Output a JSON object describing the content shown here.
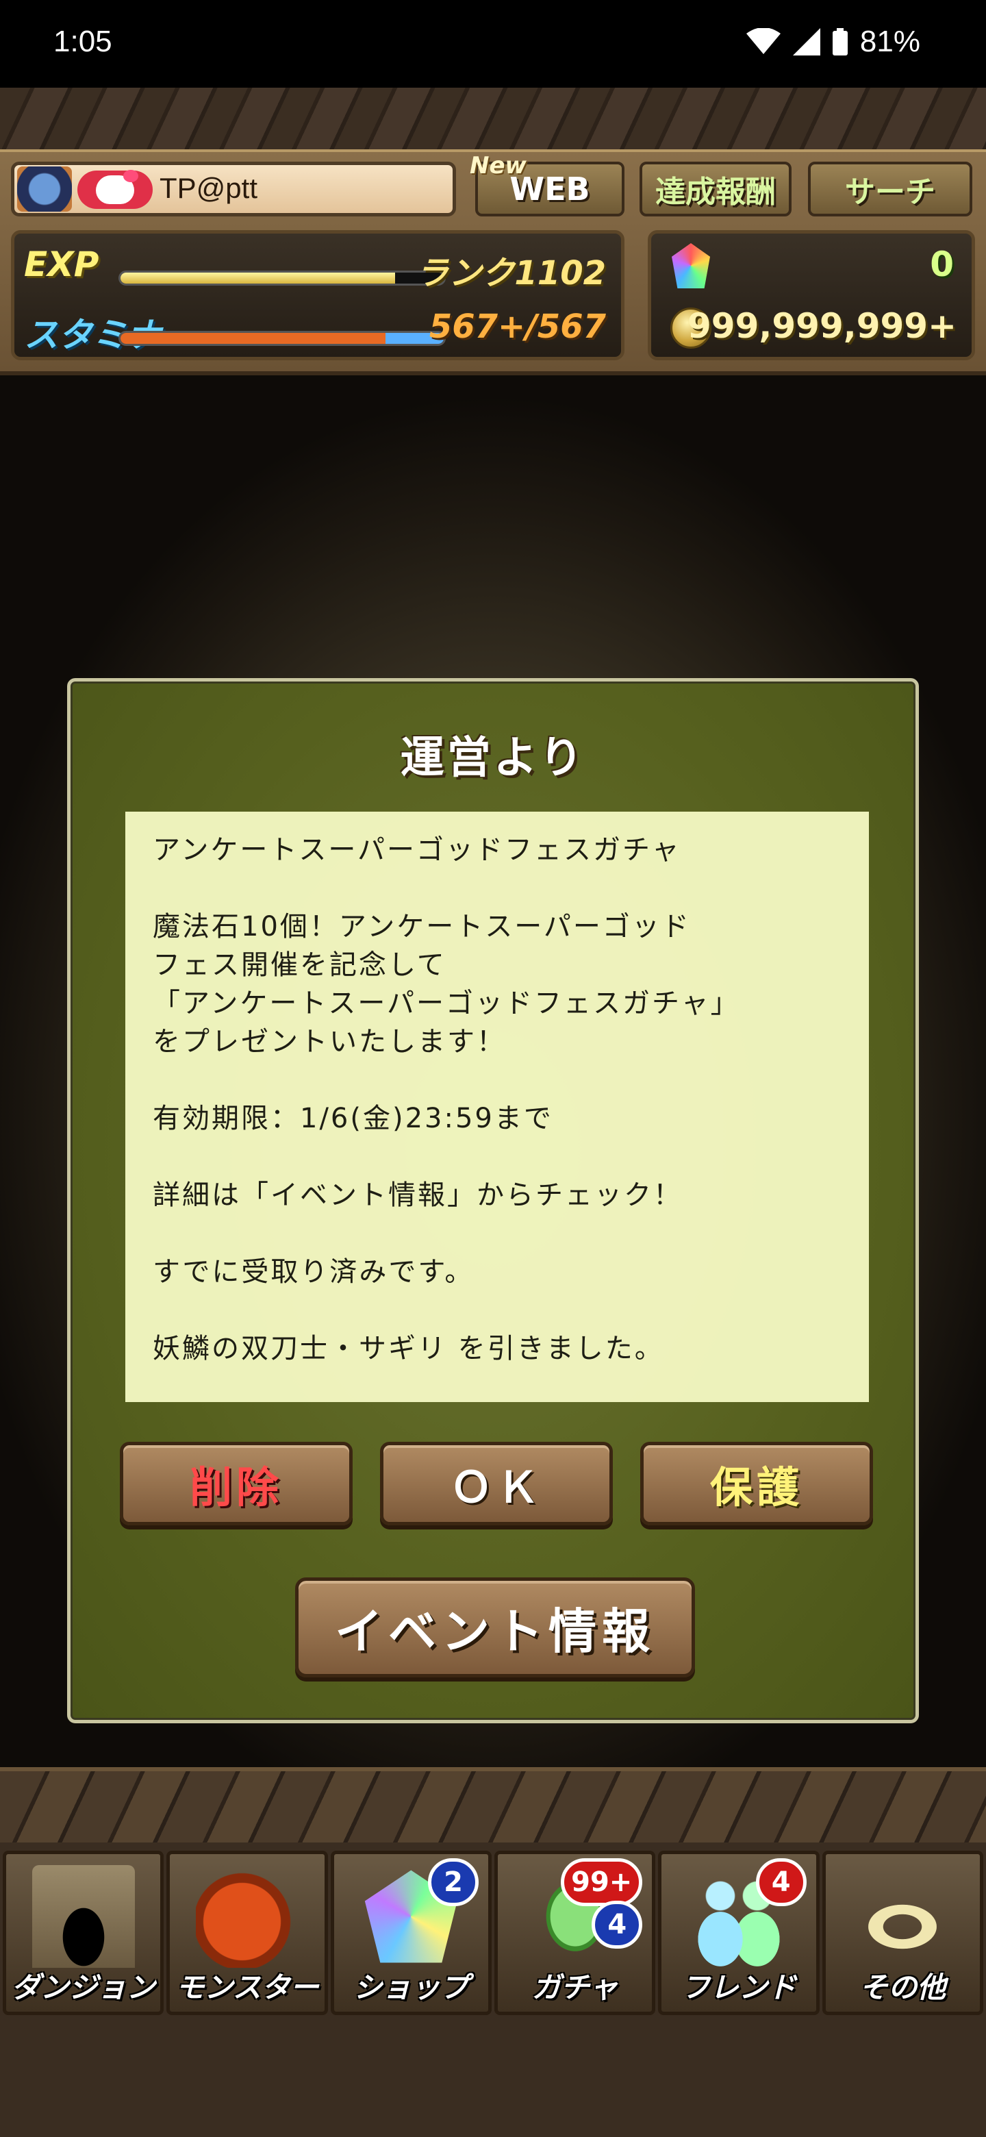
{
  "status_bar": {
    "time": "1:05",
    "battery": "81%",
    "icons": [
      "wifi-icon",
      "cellular-signal-icon",
      "battery-icon"
    ]
  },
  "header": {
    "username": "TP@ptt",
    "new_tag": "New",
    "web_label": "WEB",
    "reward_label": "達成報酬",
    "search_label": "サーチ",
    "exp_label": "EXP",
    "rank_text": "ランク1102",
    "exp_progress": 0.85,
    "stamina_label": "スタミナ",
    "stamina_text": "567+/567",
    "stamina_progress": 1.0,
    "magic_stones": "0",
    "coins": "999,999,999+"
  },
  "dialog": {
    "title": "運営より",
    "message_lines": [
      "アンケートスーパーゴッドフェスガチャ",
      "",
      "魔法石10個！アンケートスーパーゴッド",
      "フェス開催を記念して",
      "「アンケートスーパーゴッドフェスガチャ」",
      "をプレゼントいたします！",
      "",
      "有効期限：1/6(金)23:59まで",
      "",
      "詳細は「イベント情報」からチェック！",
      "",
      "すでに受取り済みです。",
      "",
      "妖鱗の双刀士・サギリ を引きました。"
    ],
    "buttons": {
      "delete": "削除",
      "ok": "ＯＫ",
      "protect": "保護",
      "event_info": "イベント情報"
    }
  },
  "nav": {
    "items": [
      {
        "label": "ダンジョン",
        "icon": "dungeon-gate-icon",
        "badges": []
      },
      {
        "label": "モンスター",
        "icon": "red-dragon-icon",
        "badges": []
      },
      {
        "label": "ショップ",
        "icon": "magic-stone-icon",
        "badges": [
          "2"
        ]
      },
      {
        "label": "ガチャ",
        "icon": "egg-icon",
        "badges": [
          "99+",
          "4"
        ]
      },
      {
        "label": "フレンド",
        "icon": "friends-icon",
        "badges": [
          "4"
        ]
      },
      {
        "label": "その他",
        "icon": "question-mark-icon",
        "badges": []
      }
    ]
  },
  "colors": {
    "dialog_bg": "#56601e",
    "message_bg": "#f6fac4",
    "delete_text": "#ff4a4a",
    "protect_text": "#fff27a",
    "badge_blue": "#1a3ab0",
    "badge_red": "#d01818"
  }
}
